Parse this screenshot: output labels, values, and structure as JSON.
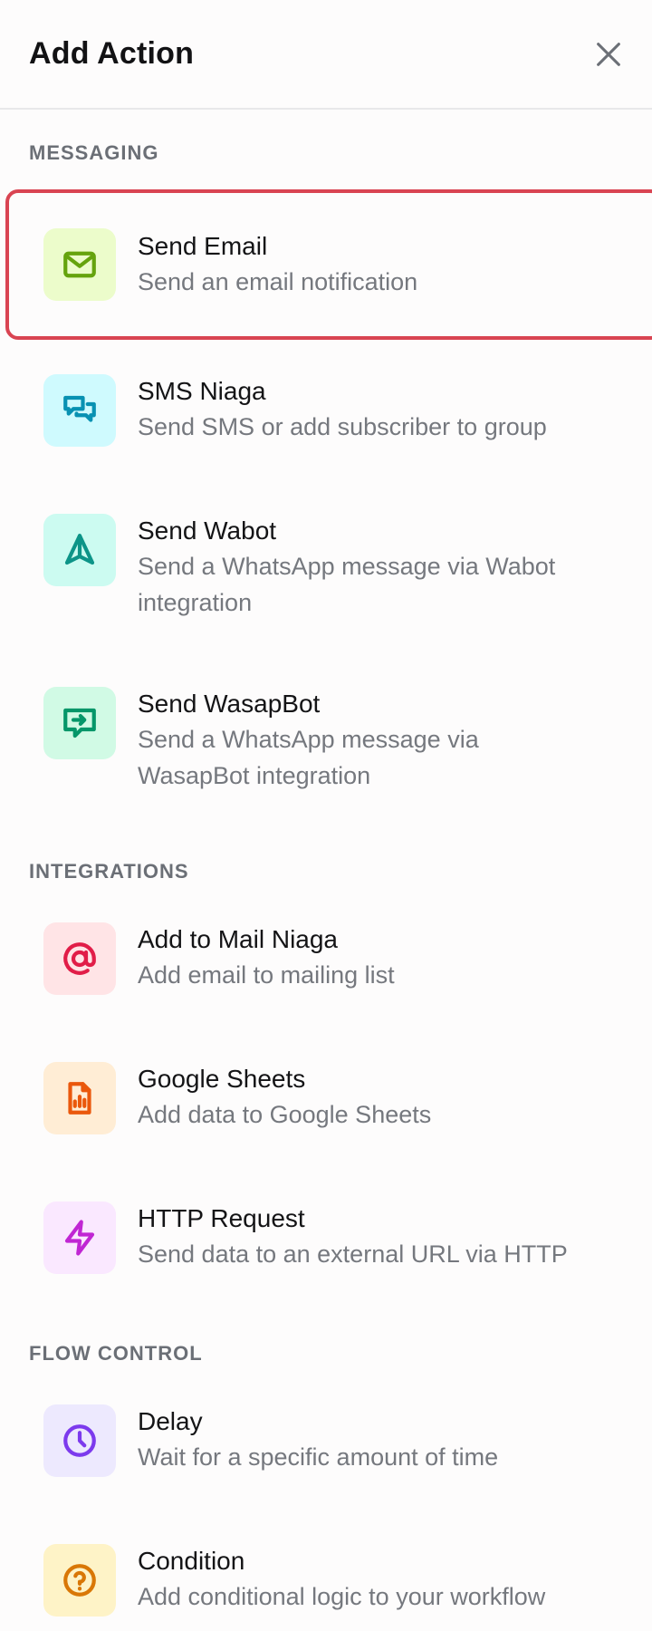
{
  "header": {
    "title": "Add Action",
    "close_icon": "close-icon"
  },
  "sections": {
    "messaging": {
      "label": "MESSAGING",
      "items": [
        {
          "title": "Send Email",
          "desc": "Send an email notification",
          "icon": "mail-icon",
          "icon_bg": "#ecfccb",
          "icon_color": "#65a30d",
          "selected": true
        },
        {
          "title": "SMS Niaga",
          "desc": "Send SMS or add subscriber to group",
          "icon": "chat-icon",
          "icon_bg": "#cffafe",
          "icon_color": "#0891b2"
        },
        {
          "title": "Send Wabot",
          "desc": "Send a WhatsApp message via Wabot integration",
          "icon": "send-triangle-icon",
          "icon_bg": "#ccfbf1",
          "icon_color": "#0d9488"
        },
        {
          "title": "Send WasapBot",
          "desc": "Send a WhatsApp message via WasapBot integration",
          "icon": "message-forward-icon",
          "icon_bg": "#d1fae5",
          "icon_color": "#059669"
        }
      ]
    },
    "integrations": {
      "label": "INTEGRATIONS",
      "items": [
        {
          "title": "Add to Mail Niaga",
          "desc": "Add email to mailing list",
          "icon": "at-sign-icon",
          "icon_bg": "#ffe4e6",
          "icon_color": "#e11d48"
        },
        {
          "title": "Google Sheets",
          "desc": "Add data to Google Sheets",
          "icon": "spreadsheet-icon",
          "icon_bg": "#ffedd5",
          "icon_color": "#ea580c"
        },
        {
          "title": "HTTP Request",
          "desc": "Send data to an external URL via HTTP",
          "icon": "lightning-icon",
          "icon_bg": "#fae8ff",
          "icon_color": "#c026d3"
        }
      ]
    },
    "flow_control": {
      "label": "FLOW CONTROL",
      "items": [
        {
          "title": "Delay",
          "desc": "Wait for a specific amount of time",
          "icon": "clock-icon",
          "icon_bg": "#ede9fe",
          "icon_color": "#7c3aed"
        },
        {
          "title": "Condition",
          "desc": "Add conditional logic to your workflow",
          "icon": "question-circle-icon",
          "icon_bg": "#fef3c7",
          "icon_color": "#d97706"
        }
      ]
    }
  }
}
